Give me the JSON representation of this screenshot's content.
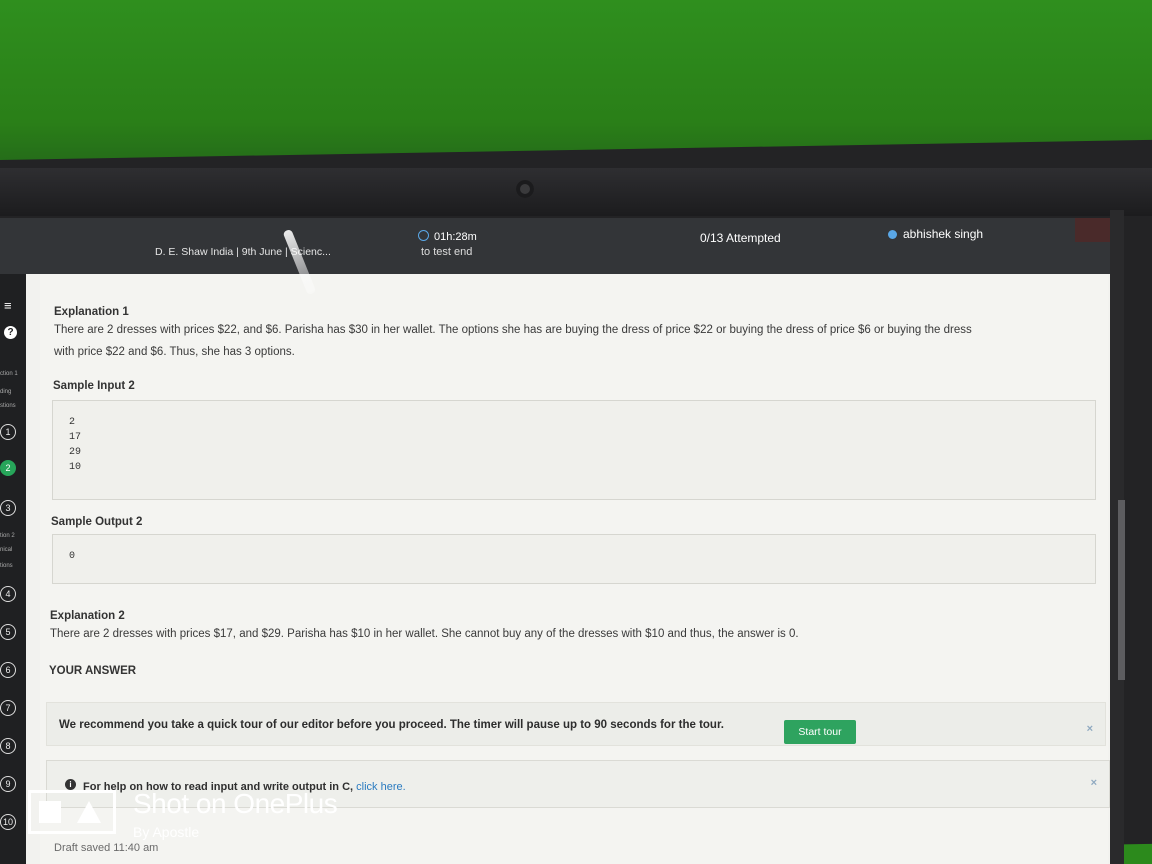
{
  "header": {
    "breadcrumb": "D. E. Shaw India | 9th June | Scienc...",
    "timer": "01h:28m",
    "timer_sub": "to test end",
    "attempted": "0/13 Attempted",
    "user": "abhishek singh"
  },
  "sidebar": {
    "section1_label": "ction 1",
    "section1_sub1": "ding",
    "section1_sub2": "stions",
    "section2_label": "tion 2",
    "section2_sub1": "nical",
    "section2_sub2": "tions",
    "questions": [
      "1",
      "2",
      "3",
      "4",
      "5",
      "6",
      "7",
      "8",
      "9",
      "10"
    ],
    "active_question": "2"
  },
  "content": {
    "explanation1_title": "Explanation 1",
    "explanation1_line1": "There are 2 dresses with prices $22, and $6. Parisha has $30 in her wallet. The options she has are buying the dress of price $22 or buying the dress of price $6 or buying the dress",
    "explanation1_line2": "with price $22 and $6. Thus, she has 3 options.",
    "sample_input2_title": "Sample Input 2",
    "sample_input2_lines": [
      "2",
      "17",
      "29",
      "10"
    ],
    "sample_output2_title": "Sample Output 2",
    "sample_output2_value": "0",
    "explanation2_title": "Explanation 2",
    "explanation2_text": "There are 2 dresses with prices $17, and $29. Parisha has $10 in her wallet. She cannot buy any of the dresses with $10 and thus, the answer is 0.",
    "your_answer_label": "YOUR ANSWER"
  },
  "tour": {
    "message": "We recommend you take a quick tour of our editor before you proceed. The timer will pause up to 90 seconds for the tour.",
    "button_label": "Start tour",
    "close": "×"
  },
  "help": {
    "text": "For help on how to read input and write output in C,",
    "link": "click here.",
    "close": "×"
  },
  "draft": "Draft saved 11:40 am",
  "watermark": {
    "title": "Shot on OnePlus",
    "subtitle": "By Apostle"
  }
}
